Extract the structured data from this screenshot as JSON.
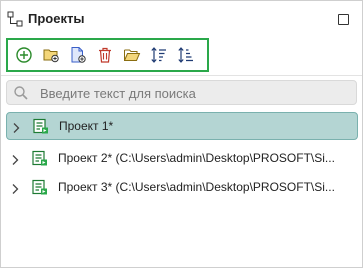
{
  "panel": {
    "title": "Проекты"
  },
  "toolbar": {
    "tools": [
      {
        "icon": "add-circle-icon",
        "color": "#2a8a2a"
      },
      {
        "icon": "new-folder-icon",
        "color": "#c9a227"
      },
      {
        "icon": "new-file-icon",
        "color": "#3a5fc8"
      },
      {
        "icon": "trash-icon",
        "color": "#c0392b"
      },
      {
        "icon": "open-folder-icon",
        "color": "#c9a227"
      },
      {
        "icon": "sort-ascending-icon",
        "color": "#1f3b73"
      },
      {
        "icon": "sort-descending-icon",
        "color": "#1f3b73"
      }
    ],
    "highlight_color": "#2aa84a"
  },
  "search": {
    "placeholder": "Введите текст для поиска",
    "value": ""
  },
  "tree": {
    "items": [
      {
        "label": "Проект 1*",
        "selected": true
      },
      {
        "label": "Проект 2* (C:\\Users\\admin\\Desktop\\PROSOFT\\Si...",
        "selected": false
      },
      {
        "label": "Проект 3* (C:\\Users\\admin\\Desktop\\PROSOFT\\Si...",
        "selected": false
      }
    ],
    "selection_color": "#b4d5d3"
  }
}
